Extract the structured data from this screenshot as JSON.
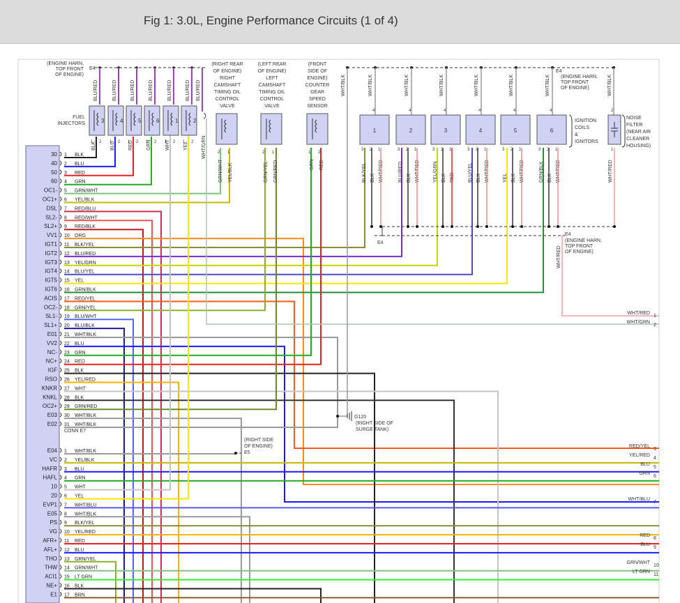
{
  "header": {
    "title": "Fig 1: 3.0L, Engine Performance Circuits (1 of 4)"
  },
  "connector": {
    "name": "CONN E7",
    "rowsA": [
      {
        "pin": "30",
        "num": "1",
        "color": "BLK",
        "hex": "#222222"
      },
      {
        "pin": "40",
        "num": "2",
        "color": "BLU",
        "hex": "#1a1aff"
      },
      {
        "pin": "50",
        "num": "3",
        "color": "RED",
        "hex": "#e52222"
      },
      {
        "pin": "60",
        "num": "4",
        "color": "GRN",
        "hex": "#22aa22"
      },
      {
        "pin": "OC1-",
        "num": "5",
        "color": "GRN/WHT",
        "hex": "#7fc27f"
      },
      {
        "pin": "OC1+",
        "num": "6",
        "color": "YEL/BLK",
        "hex": "#c9b800"
      },
      {
        "pin": "DSL",
        "num": "7",
        "color": "RED/BLU",
        "hex": "#d03050"
      },
      {
        "pin": "SL2-",
        "num": "8",
        "color": "RED/WHT",
        "hex": "#ee5555"
      },
      {
        "pin": "SL2+",
        "num": "9",
        "color": "RED/BLK",
        "hex": "#c01818"
      },
      {
        "pin": "VV1",
        "num": "10",
        "color": "ORG",
        "hex": "#ff8a1a"
      },
      {
        "pin": "IGT1",
        "num": "11",
        "color": "BLK/YEL",
        "hex": "#8a8a3a"
      },
      {
        "pin": "IGT2",
        "num": "12",
        "color": "BLU/RED",
        "hex": "#7a2ad0"
      },
      {
        "pin": "IGT3",
        "num": "13",
        "color": "YEL/GRN",
        "hex": "#c8d400"
      },
      {
        "pin": "IGT4",
        "num": "14",
        "color": "BLU/YEL",
        "hex": "#4a4acc"
      },
      {
        "pin": "IGT5",
        "num": "15",
        "color": "YEL",
        "hex": "#ffe600"
      },
      {
        "pin": "IGT6",
        "num": "16",
        "color": "GRN/BLK",
        "hex": "#2a8a3a"
      },
      {
        "pin": "ACIS",
        "num": "17",
        "color": "RED/YEL",
        "hex": "#ff5a1a"
      },
      {
        "pin": "OC2-",
        "num": "18",
        "color": "GRN/YEL",
        "hex": "#8ab02a"
      },
      {
        "pin": "SL1-",
        "num": "19",
        "color": "BLU/WHT",
        "hex": "#4a6aee"
      },
      {
        "pin": "SL1+",
        "num": "20",
        "color": "BLU/BLK",
        "hex": "#1a1aa0"
      },
      {
        "pin": "E01",
        "num": "21",
        "color": "WHT/BLK",
        "hex": "#9a9a9a"
      },
      {
        "pin": "VV2",
        "num": "22",
        "color": "BLU",
        "hex": "#1a1aff"
      },
      {
        "pin": "NC-",
        "num": "23",
        "color": "GRN",
        "hex": "#22aa22"
      },
      {
        "pin": "NC+",
        "num": "24",
        "color": "RED",
        "hex": "#e52222"
      },
      {
        "pin": "IGF",
        "num": "25",
        "color": "BLK",
        "hex": "#222222"
      },
      {
        "pin": "RSO",
        "num": "26",
        "color": "YEL/RED",
        "hex": "#ffb000"
      },
      {
        "pin": "KNKR",
        "num": "27",
        "color": "WHT",
        "hex": "#c4c4c4"
      },
      {
        "pin": "KNKL",
        "num": "28",
        "color": "BLK",
        "hex": "#333333"
      },
      {
        "pin": "OC2+",
        "num": "29",
        "color": "GRN/RED",
        "hex": "#6a8a2a"
      },
      {
        "pin": "E03",
        "num": "30",
        "color": "WHT/BLK",
        "hex": "#9a9a9a"
      },
      {
        "pin": "E02",
        "num": "31",
        "color": "WHT/BLK",
        "hex": "#9a9a9a"
      }
    ],
    "rowsB": [
      {
        "pin": "E04",
        "num": "1",
        "color": "WHT/BLK",
        "hex": "#9a9a9a"
      },
      {
        "pin": "VC",
        "num": "2",
        "color": "YEL/BLK",
        "hex": "#c9b800"
      },
      {
        "pin": "HAFR",
        "num": "3",
        "color": "BLU",
        "hex": "#1a1aff"
      },
      {
        "pin": "HAFL",
        "num": "4",
        "color": "GRN",
        "hex": "#22aa22"
      },
      {
        "pin": "10",
        "num": "5",
        "color": "WHT",
        "hex": "#c4c4c4"
      },
      {
        "pin": "20",
        "num": "6",
        "color": "YEL",
        "hex": "#ffe600"
      },
      {
        "pin": "EVP1",
        "num": "7",
        "color": "WHT/BLU",
        "hex": "#5a5aee"
      },
      {
        "pin": "E05",
        "num": "8",
        "color": "WHT/BLK",
        "hex": "#9a9a9a"
      },
      {
        "pin": "PS",
        "num": "9",
        "color": "BLK/YEL",
        "hex": "#8a8a3a"
      },
      {
        "pin": "VG",
        "num": "10",
        "color": "YEL/RED",
        "hex": "#ffb000"
      },
      {
        "pin": "AFR+",
        "num": "11",
        "color": "RED",
        "hex": "#e52222"
      },
      {
        "pin": "AFL+",
        "num": "12",
        "color": "BLU",
        "hex": "#1a1aff"
      },
      {
        "pin": "THO",
        "num": "13",
        "color": "GRN/YEL",
        "hex": "#8ab02a"
      },
      {
        "pin": "THW",
        "num": "14",
        "color": "GRN/WHT",
        "hex": "#7fc27f"
      },
      {
        "pin": "ACI1",
        "num": "15",
        "color": "LT GRN",
        "hex": "#33ee33"
      },
      {
        "pin": "NE+",
        "num": "16",
        "color": "BLK",
        "hex": "#222222"
      },
      {
        "pin": "E1",
        "num": "17",
        "color": "BRN",
        "hex": "#8a5a2a"
      }
    ]
  },
  "injectors": {
    "label": [
      "FUEL",
      "INJECTORS"
    ],
    "numbers": [
      "3",
      "4",
      "5",
      "6",
      "1",
      "2"
    ],
    "wire_labels": [
      "BLU/RED",
      "BLU/RED",
      "BLU/RED",
      "BLU/RED",
      "BLU/RED",
      "BLU/RED"
    ],
    "pin_labels": [
      "1",
      "2",
      "1",
      "2",
      "1",
      "2",
      "1",
      "2",
      "1",
      "2",
      "1",
      "2"
    ],
    "bottom_wires": [
      "BLK",
      "BLU",
      "RED",
      "GRN",
      "WHT",
      "YEL"
    ]
  },
  "e4_top_left": {
    "id": "E4",
    "label": [
      "(ENGINE HARN,",
      "TOP FRONT",
      "OF ENGINE)"
    ]
  },
  "e4_top_right": {
    "id": "E4",
    "label": [
      "(ENGINE HARN,",
      "TOP FRONT",
      "OF ENGINE)"
    ]
  },
  "e4_lower": {
    "id": "E4",
    "label": [
      "(ENGINE HARN,",
      "TOP FRONT",
      "OF ENGINE)"
    ],
    "tag": "E4"
  },
  "valve_right": {
    "label": [
      "(RIGHT REAR",
      "OF ENGINE)",
      "RIGHT",
      "CAMSHAFT",
      "TIMING OIL",
      "CONTROL",
      "VALVE"
    ],
    "wires": [
      "GRN/WHT",
      "YEL/BLK"
    ],
    "top_wire": "BLU/RED",
    "side_wire": "WHT/GRN"
  },
  "valve_left": {
    "label": [
      "(LEFT REAR",
      "OF ENGINE)",
      "LEFT",
      "CAMSHAFT",
      "TIMING OIL",
      "CONTROL",
      "VALVE"
    ],
    "wires": [
      "GRN/YEL",
      "GRN/RED"
    ]
  },
  "speed_sensor": {
    "label": [
      "(FRONT",
      "SIDE OF",
      "ENGINE)",
      "COUNTER",
      "GEAR",
      "SPEED",
      "SENSOR"
    ],
    "wires": [
      "GRN",
      "RED"
    ]
  },
  "top_wires": {
    "col1": "WHT/BLK",
    "labels": [
      "WHT/BLK",
      "WHT/BLK",
      "WHT/BLK",
      "WHT/BLK",
      "WHT/BLK",
      "WHT/BLK",
      "WHT/BLK"
    ]
  },
  "coils": {
    "numbers": [
      "1",
      "2",
      "3",
      "4",
      "5",
      "6"
    ],
    "label": [
      "IGNITION",
      "COILS",
      "&",
      "IGNITORS"
    ],
    "pins": [
      "3",
      "2",
      "1",
      "4"
    ],
    "wires": [
      [
        "BLK/YEL",
        "BLK",
        "WHT/RED"
      ],
      [
        "BLU/RED",
        "BLK",
        "WHT/RED"
      ],
      [
        "YEL/GRN",
        "BLK",
        "RED"
      ],
      [
        "BLU/YEL",
        "BLK",
        "WHT/RED"
      ],
      [
        "YEL",
        "BLK",
        "WHT/RED"
      ],
      [
        "GRN/BLK",
        "BLK",
        "WHT/RED"
      ]
    ]
  },
  "noise_filter": {
    "label": [
      "NOISE",
      "FILTER",
      "(NEAR AIR",
      "CLEANER",
      "HOUSING)"
    ],
    "wire": "WHT/RED"
  },
  "ground": {
    "id": "G120",
    "label": [
      "(RIGHT SIDE OF",
      "SURGE TANK)"
    ]
  },
  "e5": {
    "id": "E5",
    "label": [
      "(RIGHT SIDE",
      "OF ENGINE)"
    ]
  },
  "wire_vertical_labels": {
    "wht_red": "WHT/RED"
  },
  "right_outputs": [
    {
      "label": "WHT/RED",
      "num": "1"
    },
    {
      "label": "WHT/GRN",
      "num": "2"
    },
    {
      "label": "RED/YEL",
      "num": "3"
    },
    {
      "label": "YEL/RED",
      "num": "4"
    },
    {
      "label": "BLU",
      "num": "5"
    },
    {
      "label": "GRN",
      "num": "6"
    },
    {
      "label": "WHT/BLU",
      "num": "7"
    },
    {
      "label": "RED",
      "num": "8"
    },
    {
      "label": "BLU",
      "num": "9"
    },
    {
      "label": "GRN/WHT",
      "num": "10"
    },
    {
      "label": "LT GRN",
      "num": "11"
    }
  ]
}
